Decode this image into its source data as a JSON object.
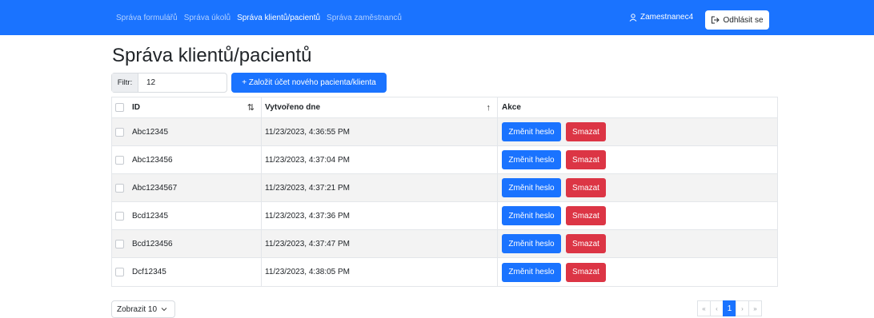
{
  "nav": {
    "links": [
      "Správa formulářů",
      "Správa úkolů",
      "Správa klientů/pacientů",
      "Správa zaměstnanců"
    ],
    "active_index": 2,
    "user": "Zamestnanec4",
    "logout_label": "Odhlásit se"
  },
  "colors": {
    "primary": "#1a73ff",
    "danger": "#dc3545"
  },
  "page": {
    "title": "Správa klientů/pacientů"
  },
  "filter": {
    "label": "Filtr:",
    "value": "12"
  },
  "new_button_label": "+ Založit účet nového pacienta/klienta",
  "table": {
    "columns": {
      "id": "ID",
      "created": "Vytvořeno dne",
      "actions": "Akce"
    },
    "sort_icons": {
      "id": "sort-both-icon",
      "created": "sort-asc-icon"
    },
    "rows": [
      {
        "id": "Abc12345",
        "created": "11/23/2023, 4:36:55 PM"
      },
      {
        "id": "Abc123456",
        "created": "11/23/2023, 4:37:04 PM"
      },
      {
        "id": "Abc1234567",
        "created": "11/23/2023, 4:37:21 PM"
      },
      {
        "id": "Bcd12345",
        "created": "11/23/2023, 4:37:36 PM"
      },
      {
        "id": "Bcd123456",
        "created": "11/23/2023, 4:37:47 PM"
      },
      {
        "id": "Dcf12345",
        "created": "11/23/2023, 4:38:05 PM"
      }
    ],
    "change_password_label": "Změnit heslo",
    "delete_label": "Smazat"
  },
  "pagesize": {
    "label": "Zobrazit 10"
  },
  "pagination": {
    "first": "«",
    "prev": "‹",
    "current": "1",
    "next": "›",
    "last": "»"
  }
}
